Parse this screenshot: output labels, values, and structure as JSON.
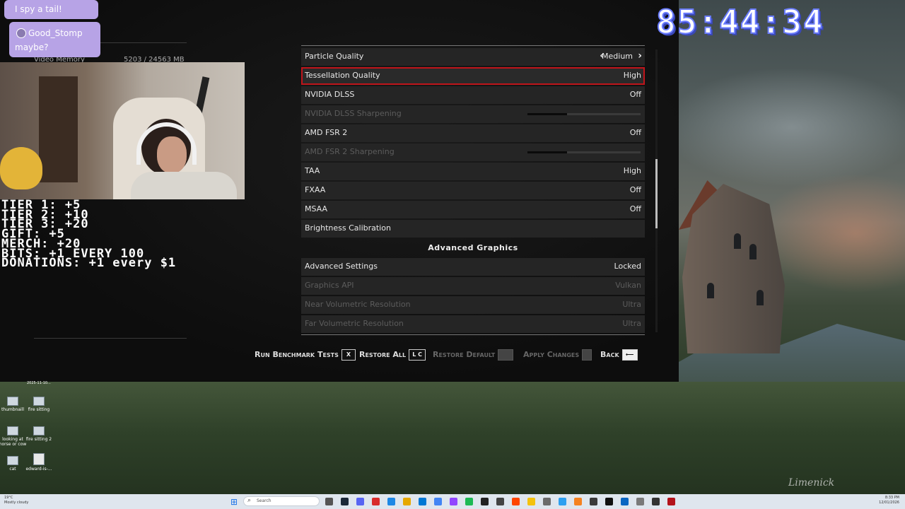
{
  "timer": "85:44:34",
  "chat": [
    {
      "user": "",
      "message": "I spy a tail!"
    },
    {
      "user": "Good_Stomp",
      "message": "maybe?"
    }
  ],
  "sub_goals": [
    "TIER 1: +5",
    "TIER 2: +10",
    "TIER 3: +20",
    "GIFT: +5",
    "MERCH: +20",
    "BITS: +1 EVERY 100",
    "DONATIONS: +1 every $1"
  ],
  "game": {
    "video_memory_label": "Video Memory",
    "video_memory_value": "5203 / 24563 MB",
    "rows": [
      {
        "label": "Particle Quality",
        "value": "Medium",
        "type": "arrows"
      },
      {
        "label": "Tessellation Quality",
        "value": "High",
        "type": "selected"
      },
      {
        "label": "NVIDIA DLSS",
        "value": "Off"
      },
      {
        "label": "NVIDIA DLSS Sharpening",
        "value": "",
        "type": "slider",
        "level": 0.35
      },
      {
        "label": "AMD FSR 2",
        "value": "Off"
      },
      {
        "label": "AMD FSR 2 Sharpening",
        "value": "",
        "type": "slider",
        "level": 0.35
      },
      {
        "label": "TAA",
        "value": "High"
      },
      {
        "label": "FXAA",
        "value": "Off"
      },
      {
        "label": "MSAA",
        "value": "Off"
      },
      {
        "label": "Brightness Calibration",
        "value": ""
      }
    ],
    "section_header": "Advanced Graphics",
    "advanced_rows": [
      {
        "label": "Advanced Settings",
        "value": "Locked"
      },
      {
        "label": "Graphics API",
        "value": "Vulkan",
        "dim": true
      },
      {
        "label": "Near Volumetric Resolution",
        "value": "Ultra",
        "dim": true
      },
      {
        "label": "Far Volumetric Resolution",
        "value": "Ultra",
        "dim": true
      }
    ],
    "actions": {
      "benchmark": "Run Benchmark Tests",
      "benchmark_key": "X",
      "restore_all": "Restore All",
      "restore_all_key": "L C",
      "restore_default": "Restore Default",
      "apply_changes": "Apply Changes",
      "back": "Back",
      "back_key": "⟵"
    }
  },
  "desktop_icons": [
    {
      "label": "thumbnaill"
    },
    {
      "label": "fire sitting"
    },
    {
      "label": "looking at horse or cow"
    },
    {
      "label": "fire sitting 2"
    },
    {
      "label": "cat"
    },
    {
      "label": "edward-is-..."
    }
  ],
  "desktop_date_label": "2025-11-10...",
  "wallpaper_signature": "Limenick",
  "taskbar": {
    "weather_temp": "19°C",
    "weather_desc": "Mostly cloudy",
    "search_placeholder": "Search",
    "time": "8:33 PM",
    "date": "12/01/2026"
  }
}
